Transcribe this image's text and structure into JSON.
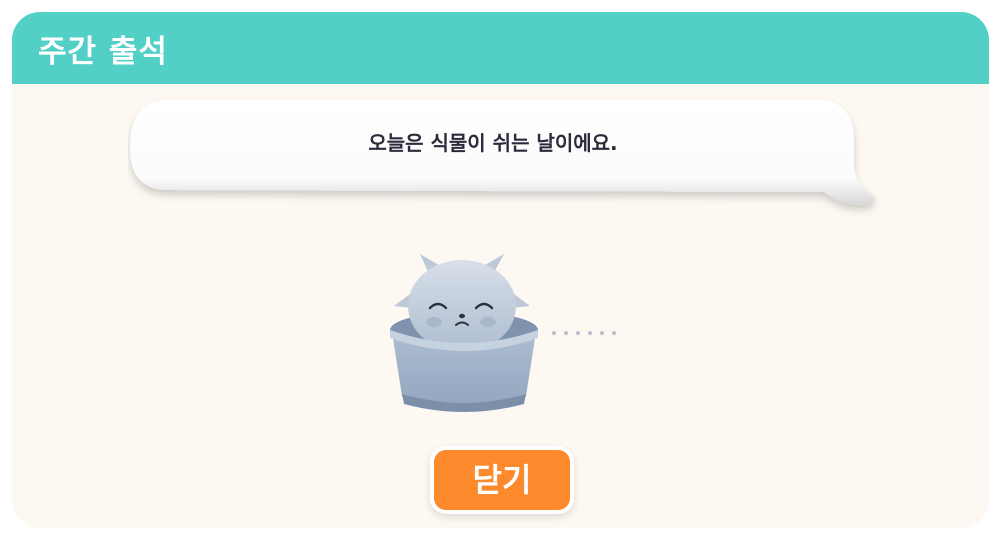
{
  "header": {
    "title": "주간 출석",
    "bg_color": "#52d0c6"
  },
  "bubble": {
    "message": "오늘은 식물이 쉬는 날이에요."
  },
  "character": {
    "icon": "sleeping-plant-in-pot-icon",
    "state": "resting"
  },
  "thinking_dots": {
    "icon": "ellipsis-dots-icon",
    "count": 6
  },
  "close_button": {
    "label": "닫기",
    "color": "#fc8a2c"
  },
  "colors": {
    "panel_bg": "#fdf8f2",
    "text_dark": "#2b2b3b",
    "pot_blue": "#9fb3cc"
  }
}
